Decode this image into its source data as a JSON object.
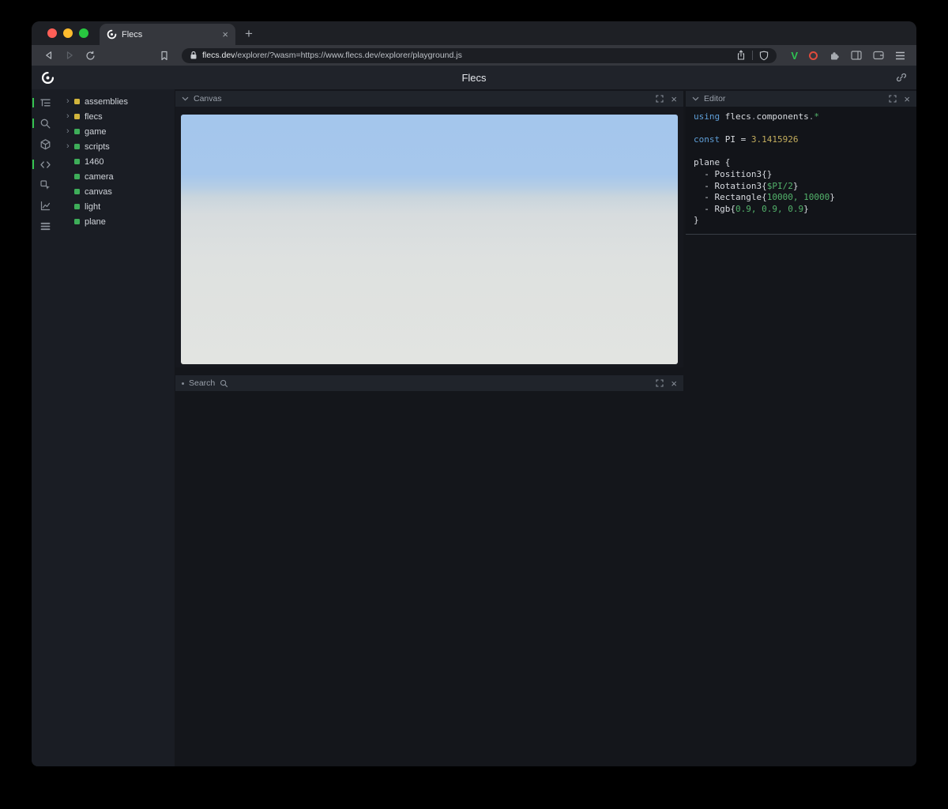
{
  "colors": {
    "accent_green": "#35c24f",
    "entity_yellow": "#d2b53c",
    "entity_green": "#3eae59",
    "sky_top": "#a4c6ec",
    "ground_bottom": "#e2e4e1",
    "code_keyword": "#5f9fd8",
    "code_value": "#53b36b",
    "code_number": "#c3ad5d",
    "traffic_red": "#ff5f57",
    "traffic_yellow": "#febc2e",
    "traffic_green": "#28c840"
  },
  "browser": {
    "tab_title": "Flecs",
    "new_tab_label": "+",
    "url_domain": "flecs.dev",
    "url_path": "/explorer/?wasm=https://www.flecs.dev/explorer/playground.js"
  },
  "app": {
    "title": "Flecs"
  },
  "sidebar_icons": [
    "outliner-icon",
    "search-icon",
    "entities-icon",
    "code-icon",
    "inspector-icon",
    "stats-icon",
    "queries-icon"
  ],
  "panels": {
    "canvas": {
      "title": "Canvas"
    },
    "search": {
      "title": "Search"
    },
    "editor": {
      "title": "Editor"
    }
  },
  "tree": {
    "items": [
      {
        "label": "assemblies",
        "expandable": true,
        "color": "#d2b53c"
      },
      {
        "label": "flecs",
        "expandable": true,
        "color": "#d2b53c"
      },
      {
        "label": "game",
        "expandable": true,
        "color": "#3eae59"
      },
      {
        "label": "scripts",
        "expandable": true,
        "color": "#3eae59"
      },
      {
        "label": "1460",
        "expandable": false,
        "color": "#3eae59"
      },
      {
        "label": "camera",
        "expandable": false,
        "color": "#3eae59"
      },
      {
        "label": "canvas",
        "expandable": false,
        "color": "#3eae59"
      },
      {
        "label": "light",
        "expandable": false,
        "color": "#3eae59"
      },
      {
        "label": "plane",
        "expandable": false,
        "color": "#3eae59"
      }
    ]
  },
  "editor": {
    "code_lines": [
      [
        {
          "t": "using",
          "c": "kw"
        },
        {
          "t": " flecs",
          "c": "pl"
        },
        {
          "t": ".",
          "c": "pu"
        },
        {
          "t": "components",
          "c": "pl"
        },
        {
          "t": ".",
          "c": "pu"
        },
        {
          "t": "*",
          "c": "val"
        }
      ],
      [],
      [
        {
          "t": "const",
          "c": "kw"
        },
        {
          "t": " PI = ",
          "c": "pl"
        },
        {
          "t": "3.1415926",
          "c": "num"
        }
      ],
      [],
      [
        {
          "t": "plane {",
          "c": "pl"
        }
      ],
      [
        {
          "t": "  - Position3{}",
          "c": "pl"
        }
      ],
      [
        {
          "t": "  - Rotation3{",
          "c": "pl"
        },
        {
          "t": "$PI/2",
          "c": "val"
        },
        {
          "t": "}",
          "c": "pl"
        }
      ],
      [
        {
          "t": "  - Rectangle{",
          "c": "pl"
        },
        {
          "t": "10000, 10000",
          "c": "val"
        },
        {
          "t": "}",
          "c": "pl"
        }
      ],
      [
        {
          "t": "  - Rgb{",
          "c": "pl"
        },
        {
          "t": "0.9, 0.9, 0.9",
          "c": "val"
        },
        {
          "t": "}",
          "c": "pl"
        }
      ],
      [
        {
          "t": "}",
          "c": "pl"
        }
      ]
    ]
  }
}
